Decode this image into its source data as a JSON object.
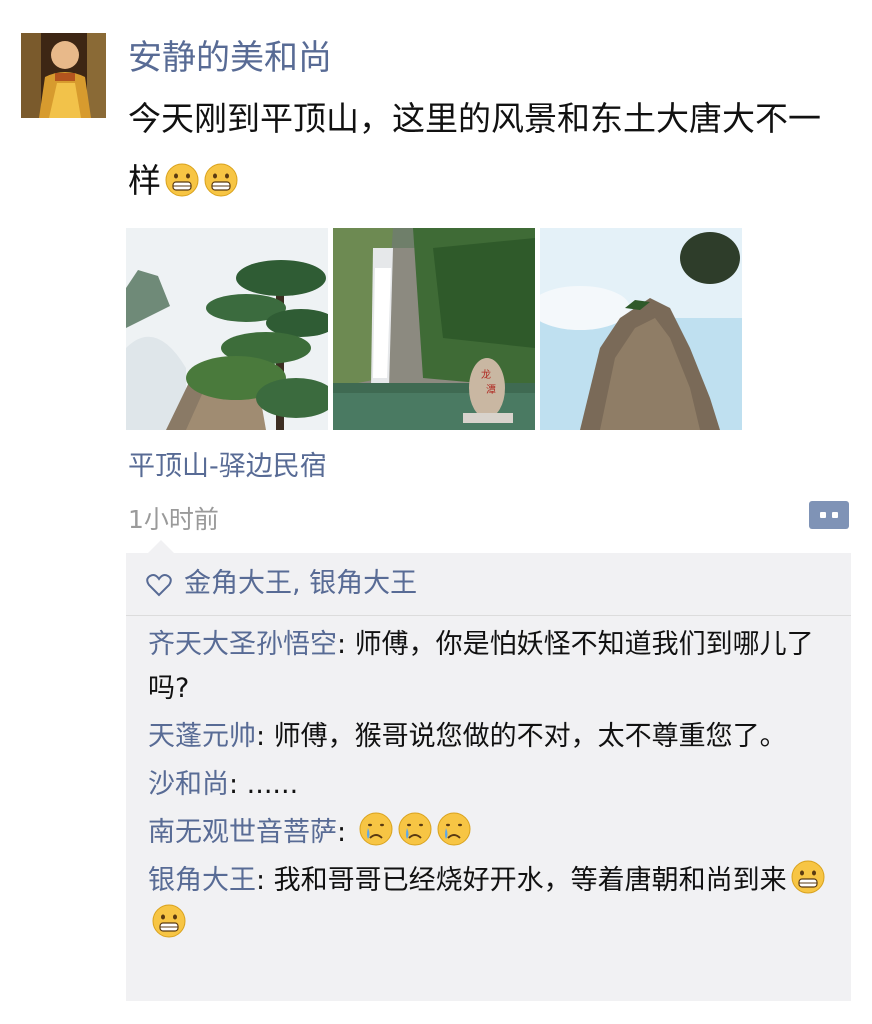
{
  "post": {
    "author": "安静的美和尚",
    "text": "今天刚到平顶山，这里的风景和东土大唐大不一样",
    "text_emojis": [
      "grin-emoji",
      "grin-emoji"
    ],
    "photos": [
      {
        "name": "pine-tree-cliff-photo"
      },
      {
        "name": "waterfall-pool-photo"
      },
      {
        "name": "rock-peak-photo"
      }
    ],
    "location": "平顶山-驿边民宿",
    "time": "1小时前"
  },
  "likes": {
    "icon": "heart-icon",
    "names": "金角大王, 银角大王"
  },
  "comments": [
    {
      "name": "齐天大圣孙悟空",
      "text": ": 师傅，你是怕妖怪不知道我们到哪儿了吗?",
      "emojis": []
    },
    {
      "name": "天蓬元帅",
      "text": ": 师傅，猴哥说您做的不对，太不尊重您了。",
      "emojis": []
    },
    {
      "name": "沙和尚",
      "text": ": ......",
      "emojis": []
    },
    {
      "name": "南无观世音菩萨",
      "text": ": ",
      "emojis": [
        "cry-emoji",
        "cry-emoji",
        "cry-emoji"
      ]
    },
    {
      "name": "银角大王",
      "text": ": 我和哥哥已经烧好开水，等着唐朝和尚到来",
      "emojis": [
        "grin-emoji",
        "grin-emoji"
      ]
    }
  ],
  "colors": {
    "link": "#586b95",
    "text": "#111111",
    "time": "#9a9a9a",
    "bubble": "#f1f1f3",
    "action": "#7f93b6"
  }
}
